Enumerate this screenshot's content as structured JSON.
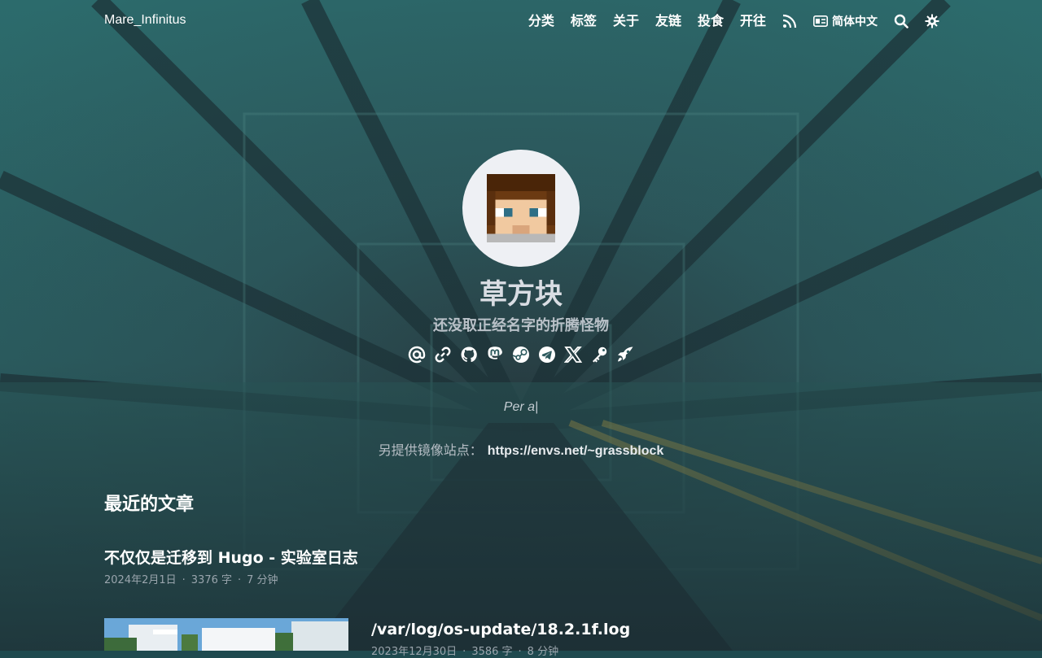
{
  "site": {
    "logo": "Mare_Infinitus"
  },
  "nav": {
    "items": [
      "分类",
      "标签",
      "关于",
      "友链",
      "投食",
      "开往"
    ],
    "rss_icon": "rss-icon",
    "lang_label": "简体中文",
    "lang_icon": "language-card-icon",
    "search_icon": "search-icon",
    "theme_icon": "gear-icon"
  },
  "profile": {
    "name": "草方块",
    "bio": "还没取正经名字的折腾怪物",
    "socials": [
      "email-icon",
      "link-icon",
      "github-icon",
      "mastodon-icon",
      "steam-icon",
      "telegram-icon",
      "x-icon",
      "key-icon",
      "rocket-icon"
    ]
  },
  "motto": "Per a|",
  "mirror": {
    "label": "另提供镜像站点：",
    "url": "https://envs.net/~grassblock"
  },
  "recent": {
    "heading": "最近的文章",
    "posts": [
      {
        "title": "不仅仅是迁移到 Hugo - 实验室日志",
        "date": "2024年2月1日",
        "words": "3376 字",
        "read": "7 分钟"
      },
      {
        "title": "/var/log/os-update/18.2.1f.log",
        "date": "2023年12月30日",
        "words": "3586 字",
        "read": "8 分钟"
      }
    ]
  },
  "colors": {
    "accent": "#ffffff",
    "muted": "#9aa5ad",
    "avatar_bg": "#eef0f4"
  }
}
